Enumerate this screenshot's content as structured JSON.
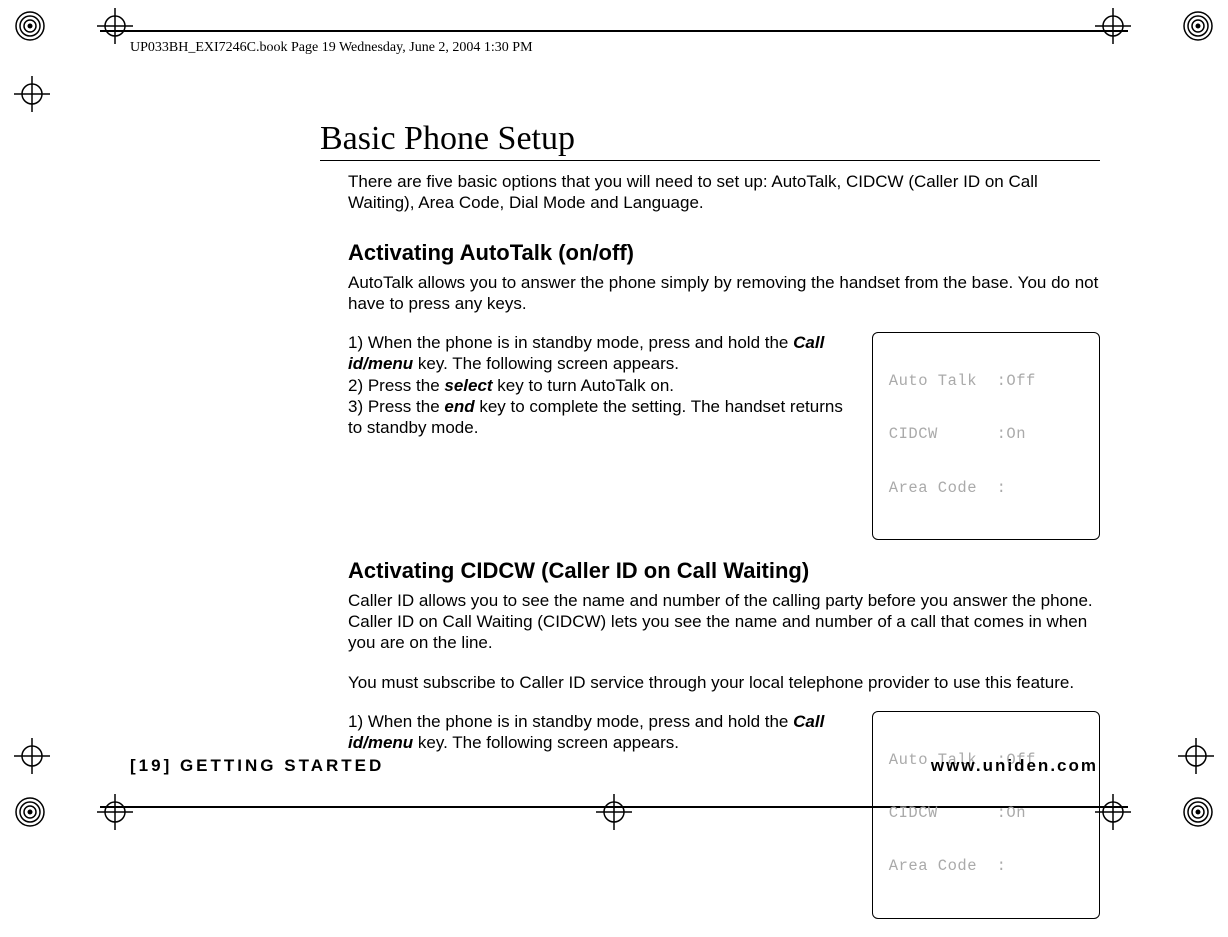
{
  "header": {
    "book_meta": "UP033BH_EXI7246C.book  Page 19  Wednesday, June 2, 2004  1:30 PM"
  },
  "title": "Basic Phone Setup",
  "intro": "There are five basic options that you will need to set up: AutoTalk, CIDCW (Caller ID on Call Waiting), Area Code, Dial Mode and Language.",
  "section1": {
    "title": "Activating AutoTalk (on/off)",
    "body": "AutoTalk allows you to answer the phone simply by removing the handset from the base. You do not have to press any keys.",
    "steps": {
      "s1a": "1) When the phone is in standby mode, press and hold the ",
      "s1key": "Call id/menu",
      "s1b": " key. The following screen appears.",
      "s2a": "2) Press the ",
      "s2key": "select",
      "s2b": " key to turn AutoTalk on.",
      "s3a": "3) Press the ",
      "s3key": "end",
      "s3b": " key to complete the setting. The handset returns to standby mode."
    },
    "lcd": {
      "line1": " Auto Talk  :Off",
      "line2": " CIDCW      :On",
      "line3": " Area Code  :"
    }
  },
  "section2": {
    "title": "Activating CIDCW (Caller ID on Call Waiting)",
    "body1": "Caller ID allows you to see the name and number of the calling party before you answer the phone. Caller ID on Call Waiting (CIDCW) lets you see the name and number of a call that comes in when you are on the line.",
    "body2": "You must subscribe to Caller ID service through your local telephone provider to use this feature.",
    "steps": {
      "s1a": "1) When the phone is in standby mode, press and hold the ",
      "s1key": "Call id/menu",
      "s1b": " key. The following screen appears."
    },
    "lcd": {
      "line1": " Auto Talk  :Off",
      "line2": " CIDCW      :On",
      "line3": " Area Code  :"
    }
  },
  "footer": {
    "left": "[19] GETTING STARTED",
    "right": "www.uniden.com"
  }
}
